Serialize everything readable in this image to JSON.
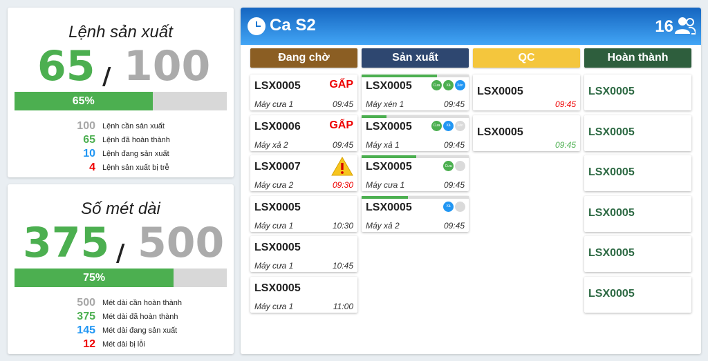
{
  "orders": {
    "title": "Lệnh sản xuất",
    "done": "65",
    "slash": "/",
    "total": "100",
    "progress_label": "65%",
    "progress": 0.65,
    "stats": [
      {
        "num": "100",
        "label": "Lệnh cần sản xuất",
        "color": "grey"
      },
      {
        "num": "65",
        "label": "Lệnh đã hoàn thành",
        "color": "green"
      },
      {
        "num": "10",
        "label": "Lệnh đang sản xuất",
        "color": "blue"
      },
      {
        "num": "4",
        "label": "Lệnh sản xuất bị trễ",
        "color": "red"
      }
    ]
  },
  "meters": {
    "title": "Số mét dài",
    "done": "375",
    "slash": "/",
    "total": "500",
    "progress_label": "75%",
    "progress": 0.75,
    "stats": [
      {
        "num": "500",
        "label": "Mét dài cần hoàn thành",
        "color": "grey"
      },
      {
        "num": "375",
        "label": "Mét dài đã hoàn thành",
        "color": "green"
      },
      {
        "num": "145",
        "label": "Mét dài đang sản xuất",
        "color": "blue"
      },
      {
        "num": "12",
        "label": "Mét dài bị lỗi",
        "color": "red"
      }
    ]
  },
  "board": {
    "shift": "Ca S2",
    "people_count": "16",
    "header_gradient": [
      "#1565c0",
      "#42a5f5"
    ],
    "columns": {
      "waiting": {
        "title": "Đang chờ",
        "color": "#8b5e23",
        "tasks": [
          {
            "code": "LSX0005",
            "machine": "Máy cưa 1",
            "time": "09:45",
            "urgent": "GẤP"
          },
          {
            "code": "LSX0006",
            "machine": "Máy xả 2",
            "time": "09:45",
            "urgent": "GẤP"
          },
          {
            "code": "LSX0007",
            "machine": "Máy cưa 2",
            "time": "09:30",
            "warning": true,
            "time_state": "late"
          },
          {
            "code": "LSX0005",
            "machine": "Máy cưa 1",
            "time": "10:30"
          },
          {
            "code": "LSX0005",
            "machine": "Máy cưa 1",
            "time": "10:45"
          },
          {
            "code": "LSX0005",
            "machine": "Máy cưa 1",
            "time": "11:00"
          }
        ]
      },
      "production": {
        "title": "Sản xuất",
        "color": "#2e4770",
        "tasks": [
          {
            "code": "LSX0005",
            "machine": "Máy xén 1",
            "time": "09:45",
            "progress": 0.7,
            "steps": [
              {
                "label": "Cưa",
                "state": "done"
              },
              {
                "label": "Xả",
                "state": "done"
              },
              {
                "label": "Xén",
                "state": "active"
              }
            ]
          },
          {
            "code": "LSX0005",
            "machine": "Máy xả 1",
            "time": "09:45",
            "progress": 0.23,
            "steps": [
              {
                "label": "Cưa",
                "state": "done"
              },
              {
                "label": "Xả",
                "state": "active"
              },
              {
                "label": "Xén",
                "state": "todo"
              }
            ]
          },
          {
            "code": "LSX0005",
            "machine": "Máy cưa 1",
            "time": "09:45",
            "progress": 0.51,
            "steps": [
              {
                "label": "Cưa",
                "state": "done"
              },
              {
                "label": "",
                "state": "todo"
              }
            ]
          },
          {
            "code": "LSX0005",
            "machine": "Máy xả 2",
            "time": "09:45",
            "progress": 0.43,
            "steps": [
              {
                "label": "Xả",
                "state": "active"
              },
              {
                "label": "",
                "state": "todo"
              }
            ]
          }
        ]
      },
      "qc": {
        "title": "QC",
        "color": "#f4c63d",
        "tasks": [
          {
            "code": "LSX0005",
            "time": "09:45",
            "time_state": "late"
          },
          {
            "code": "LSX0005",
            "time": "09:45",
            "time_state": "ok"
          }
        ]
      },
      "done": {
        "title": "Hoàn thành",
        "color": "#2e5e3d",
        "tasks": [
          {
            "code": "LSX0005"
          },
          {
            "code": "LSX0005"
          },
          {
            "code": "LSX0005"
          },
          {
            "code": "LSX0005"
          },
          {
            "code": "LSX0005"
          },
          {
            "code": "LSX0005"
          }
        ]
      }
    }
  }
}
